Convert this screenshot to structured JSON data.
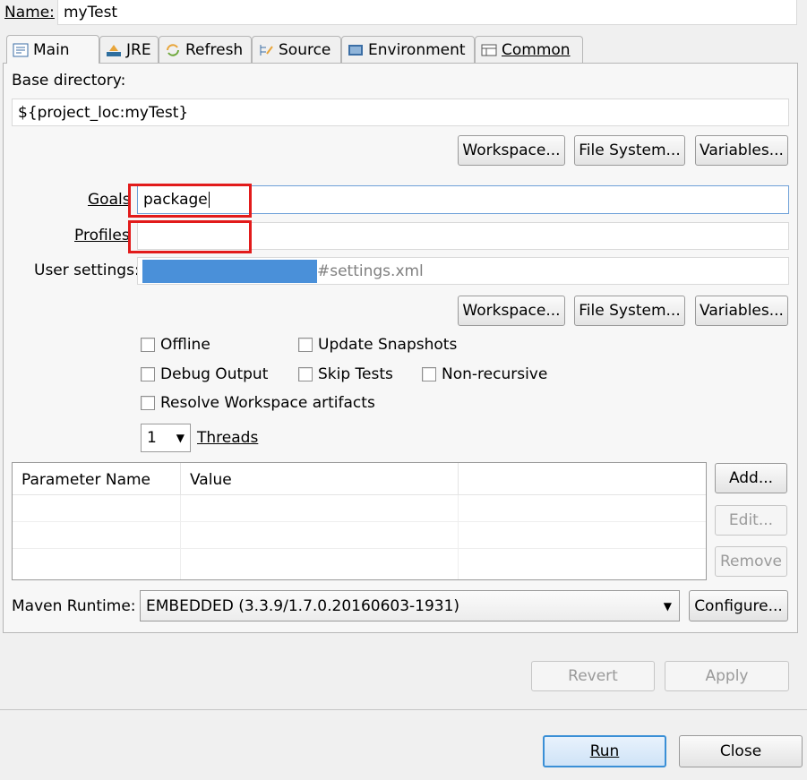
{
  "name_label": "Name:",
  "name_value": "myTest",
  "tabs": [
    {
      "label": "Main",
      "icon": "main-tab-icon"
    },
    {
      "label": "JRE",
      "icon": "jre-icon"
    },
    {
      "label": "Refresh",
      "icon": "refresh-icon"
    },
    {
      "label": "Source",
      "icon": "source-icon"
    },
    {
      "label": "Environment",
      "icon": "environment-icon"
    },
    {
      "label": "Common",
      "icon": "common-icon"
    }
  ],
  "base_dir": {
    "label": "Base directory:",
    "value": "${project_loc:myTest}",
    "buttons": {
      "workspace": "Workspace...",
      "file_system": "File System...",
      "variables": "Variables..."
    }
  },
  "goals": {
    "label": "Goals",
    "value": "package"
  },
  "profiles": {
    "label": "Profiles",
    "value": ""
  },
  "user_settings": {
    "label": "User settings:",
    "value_suffix": "#settings.xml",
    "buttons": {
      "workspace": "Workspace...",
      "file_system": "File System...",
      "variables": "Variables..."
    }
  },
  "options": {
    "offline": "Offline",
    "update_snapshots": "Update Snapshots",
    "debug_output": "Debug Output",
    "skip_tests": "Skip Tests",
    "non_recursive": "Non-recursive",
    "resolve_workspace": "Resolve Workspace artifacts"
  },
  "threads": {
    "value": "1",
    "label": "Threads"
  },
  "params_table": {
    "columns": [
      "Parameter Name",
      "Value",
      ""
    ],
    "buttons": {
      "add": "Add...",
      "edit": "Edit...",
      "remove": "Remove"
    }
  },
  "runtime": {
    "label": "Maven Runtime:",
    "value": "EMBEDDED (3.3.9/1.7.0.20160603-1931)",
    "configure": "Configure..."
  },
  "footer": {
    "revert": "Revert",
    "apply": "Apply",
    "run": "Run",
    "close": "Close"
  },
  "colors": {
    "highlight": "#e21b1b",
    "redaction": "#4a90d9",
    "run_border": "#3a8fd6"
  }
}
